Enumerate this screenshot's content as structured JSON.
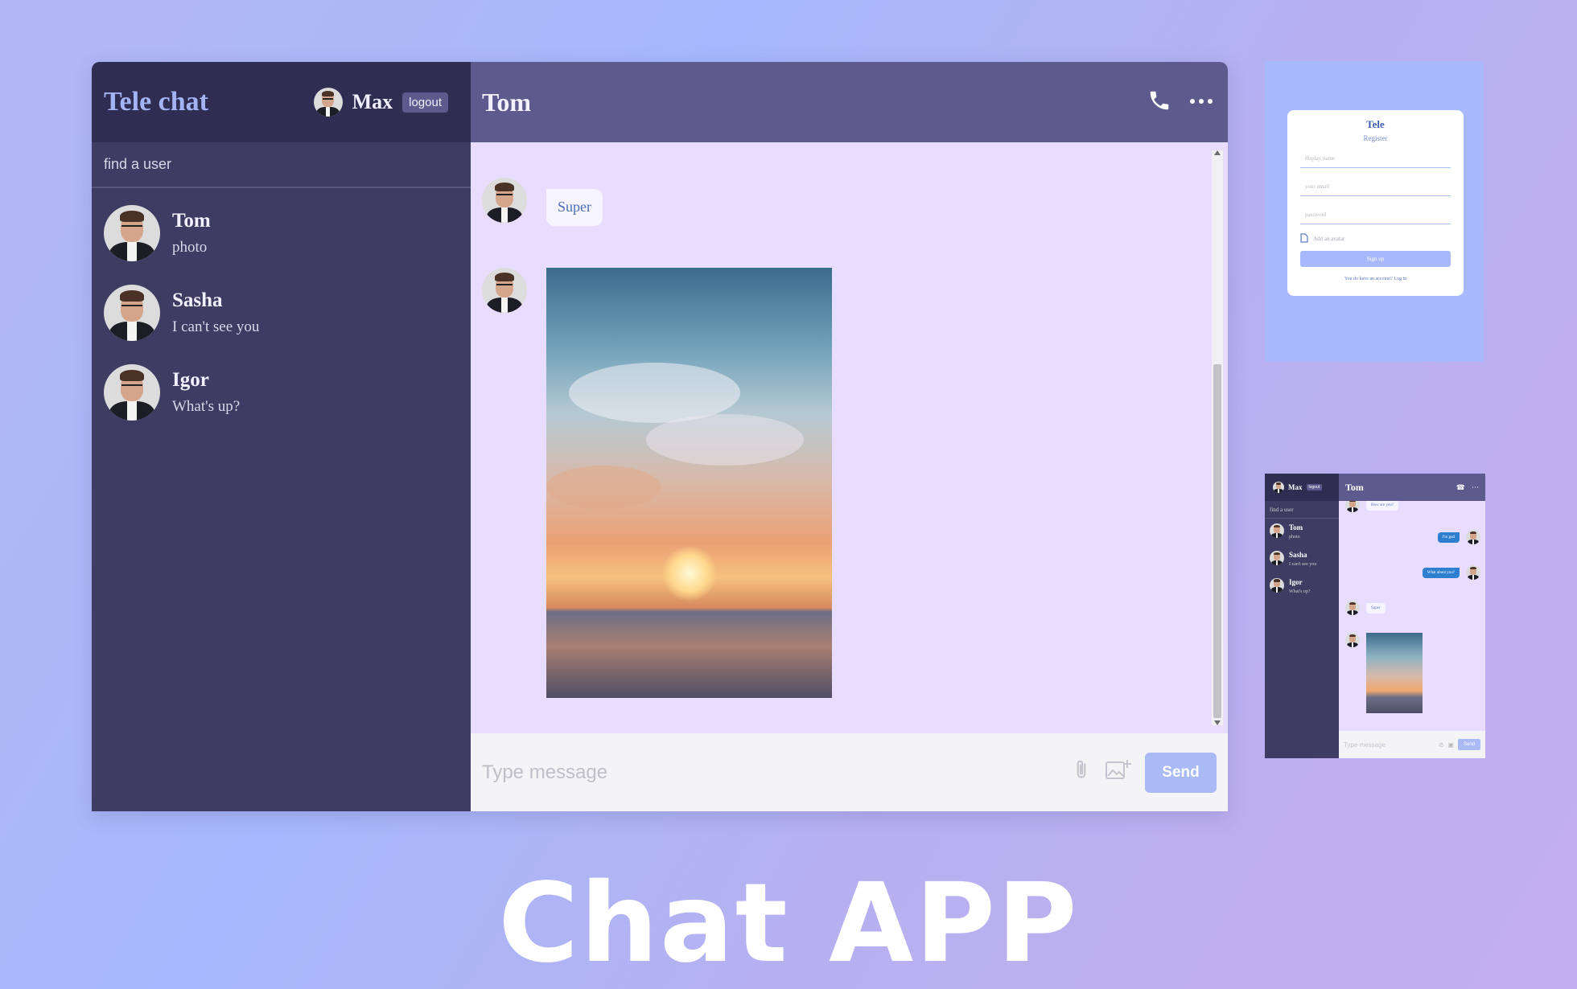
{
  "app": {
    "logo": "Tele chat",
    "current_user": "Max",
    "logout_label": "logout",
    "search_placeholder": "find a user",
    "chats": [
      {
        "name": "Tom",
        "last": "photo"
      },
      {
        "name": "Sasha",
        "last": "I can't see you"
      },
      {
        "name": "Igor",
        "last": "What's up?"
      }
    ],
    "active_chat": "Tom",
    "messages": [
      {
        "type": "text",
        "text": "Super"
      },
      {
        "type": "image",
        "alt": "sunset over sea"
      }
    ],
    "input_placeholder": "Type message",
    "send_label": "Send",
    "icons": [
      "phone-icon",
      "more-icon",
      "attach-icon",
      "add-image-icon"
    ]
  },
  "register": {
    "title": "Tele",
    "subtitle": "Register",
    "fields": [
      "display name",
      "your email",
      "password"
    ],
    "avatar_label": "Add an avatar",
    "button": "Sign up",
    "footer": "You do have an account? Log in"
  },
  "mini": {
    "user": "Max",
    "logout": "logout",
    "search": "find a user",
    "chats": [
      {
        "name": "Tom",
        "last": "photo"
      },
      {
        "name": "Sasha",
        "last": "I can't see you"
      },
      {
        "name": "Igor",
        "last": "What's up?"
      }
    ],
    "title": "Tom",
    "messages": [
      "How are you?",
      "I'm god",
      "What about you?",
      "Super"
    ],
    "input_placeholder": "Type message",
    "send": "Send"
  },
  "caption": "Chat APP",
  "colors": {
    "sidebar": "#3e3c62",
    "header": "#5d5a8d",
    "chat_bg": "#e8ddfe",
    "accent": "#a9baf5"
  }
}
